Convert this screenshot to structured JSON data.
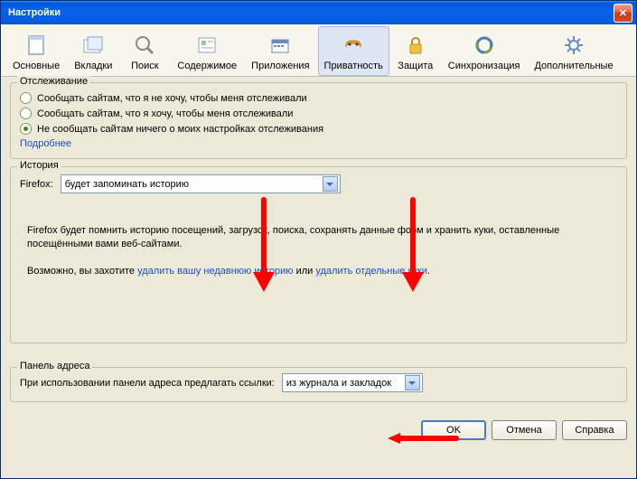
{
  "window": {
    "title": "Настройки"
  },
  "toolbar": {
    "items": [
      {
        "label": "Основные"
      },
      {
        "label": "Вкладки"
      },
      {
        "label": "Поиск"
      },
      {
        "label": "Содержимое"
      },
      {
        "label": "Приложения"
      },
      {
        "label": "Приватность"
      },
      {
        "label": "Защита"
      },
      {
        "label": "Синхронизация"
      },
      {
        "label": "Дополнительные"
      }
    ]
  },
  "tracking": {
    "legend": "Отслеживание",
    "opt1": "Сообщать сайтам, что я не хочу, чтобы меня отслеживали",
    "opt2": "Сообщать сайтам, что я хочу, чтобы меня отслеживали",
    "opt3": "Не сообщать сайтам ничего о моих настройках отслеживания",
    "more": "Подробнее"
  },
  "history": {
    "legend": "История",
    "label": "Firefox:",
    "selected": "будет запоминать историю",
    "desc": "Firefox будет помнить историю посещений, загрузок, поиска, сохранять данные форм и хранить куки, оставленные посещёнными вами веб-сайтами.",
    "maybe_pre": "Возможно, вы захотите ",
    "link1": "удалить вашу недавнюю историю",
    "mid": " или ",
    "link2": "удалить отдельные куки",
    "end": "."
  },
  "addrbar": {
    "legend": "Панель адреса",
    "label": "При использовании панели адреса предлагать ссылки:",
    "selected": "из журнала и закладок"
  },
  "buttons": {
    "ok": "OK",
    "cancel": "Отмена",
    "help": "Справка"
  }
}
